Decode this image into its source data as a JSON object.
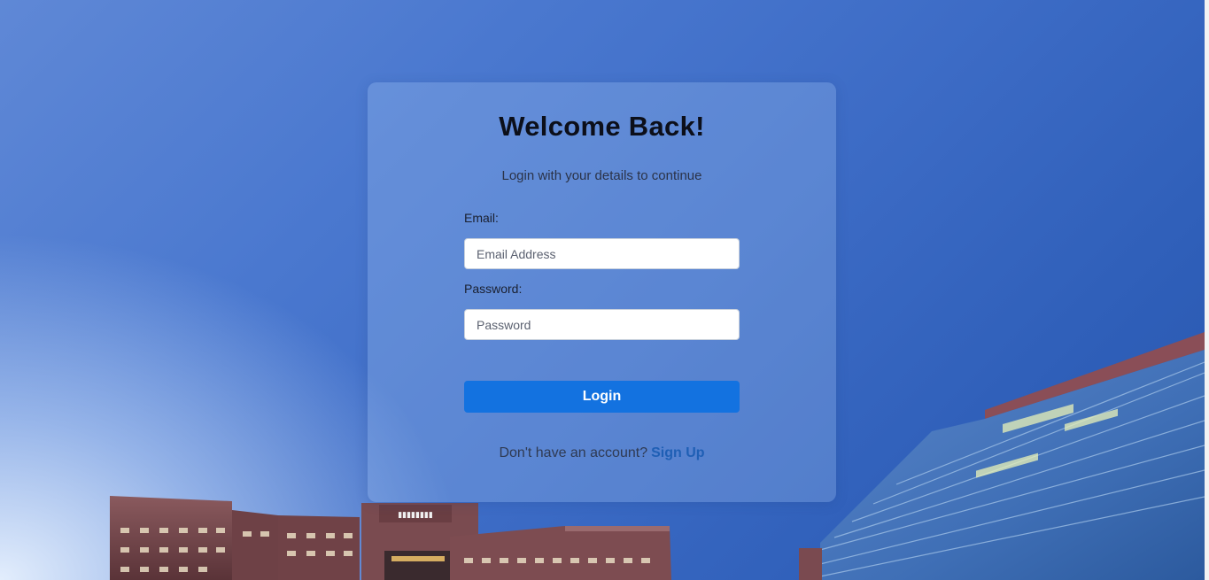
{
  "login": {
    "title": "Welcome Back!",
    "subtitle": "Login with your details to continue",
    "email_label": "Email:",
    "email_placeholder": "Email Address",
    "email_value": "",
    "password_label": "Password:",
    "password_placeholder": "Password",
    "password_value": "",
    "submit_label": "Login",
    "signup_prompt": "Don't have an account?",
    "signup_link": "Sign Up"
  },
  "colors": {
    "accent": "#1372e0",
    "link": "#1f5fb5",
    "sky_top": "#2856ad",
    "sky_bottom": "#e6f0fc"
  }
}
